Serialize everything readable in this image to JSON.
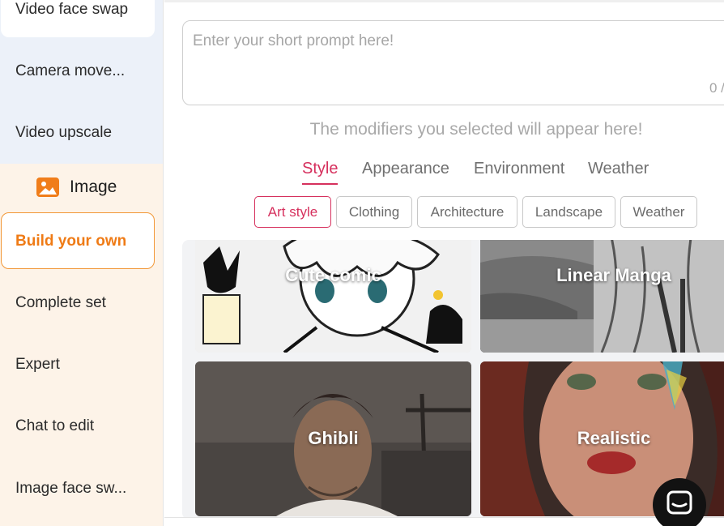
{
  "sidebar": {
    "video_items": [
      "Video face swap",
      "Camera move...",
      "Video upscale"
    ],
    "image_section": {
      "label": "Image",
      "icon": "image-icon"
    },
    "image_items": [
      "Build your own",
      "Complete set",
      "Expert",
      "Chat to edit",
      "Image face sw..."
    ],
    "active_item": "Build your own",
    "accent_color": "#ef7b16"
  },
  "prompt": {
    "placeholder": "Enter your short prompt here!",
    "value": "",
    "counter": "0 /"
  },
  "modifiers_hint": "The modifiers you selected will appear here!",
  "tabs": {
    "items": [
      "Style",
      "Appearance",
      "Environment",
      "Weather"
    ],
    "active": "Style",
    "accent_color": "#d6305d"
  },
  "chips": {
    "items": [
      "Art style",
      "Clothing",
      "Architecture",
      "Landscape",
      "Weather"
    ],
    "active": "Art style"
  },
  "gallery": {
    "cards": [
      "Cute comic",
      "Linear Manga",
      "Ghibli",
      "Realistic"
    ]
  },
  "chat_button": {
    "icon": "chat-bubble-icon"
  }
}
